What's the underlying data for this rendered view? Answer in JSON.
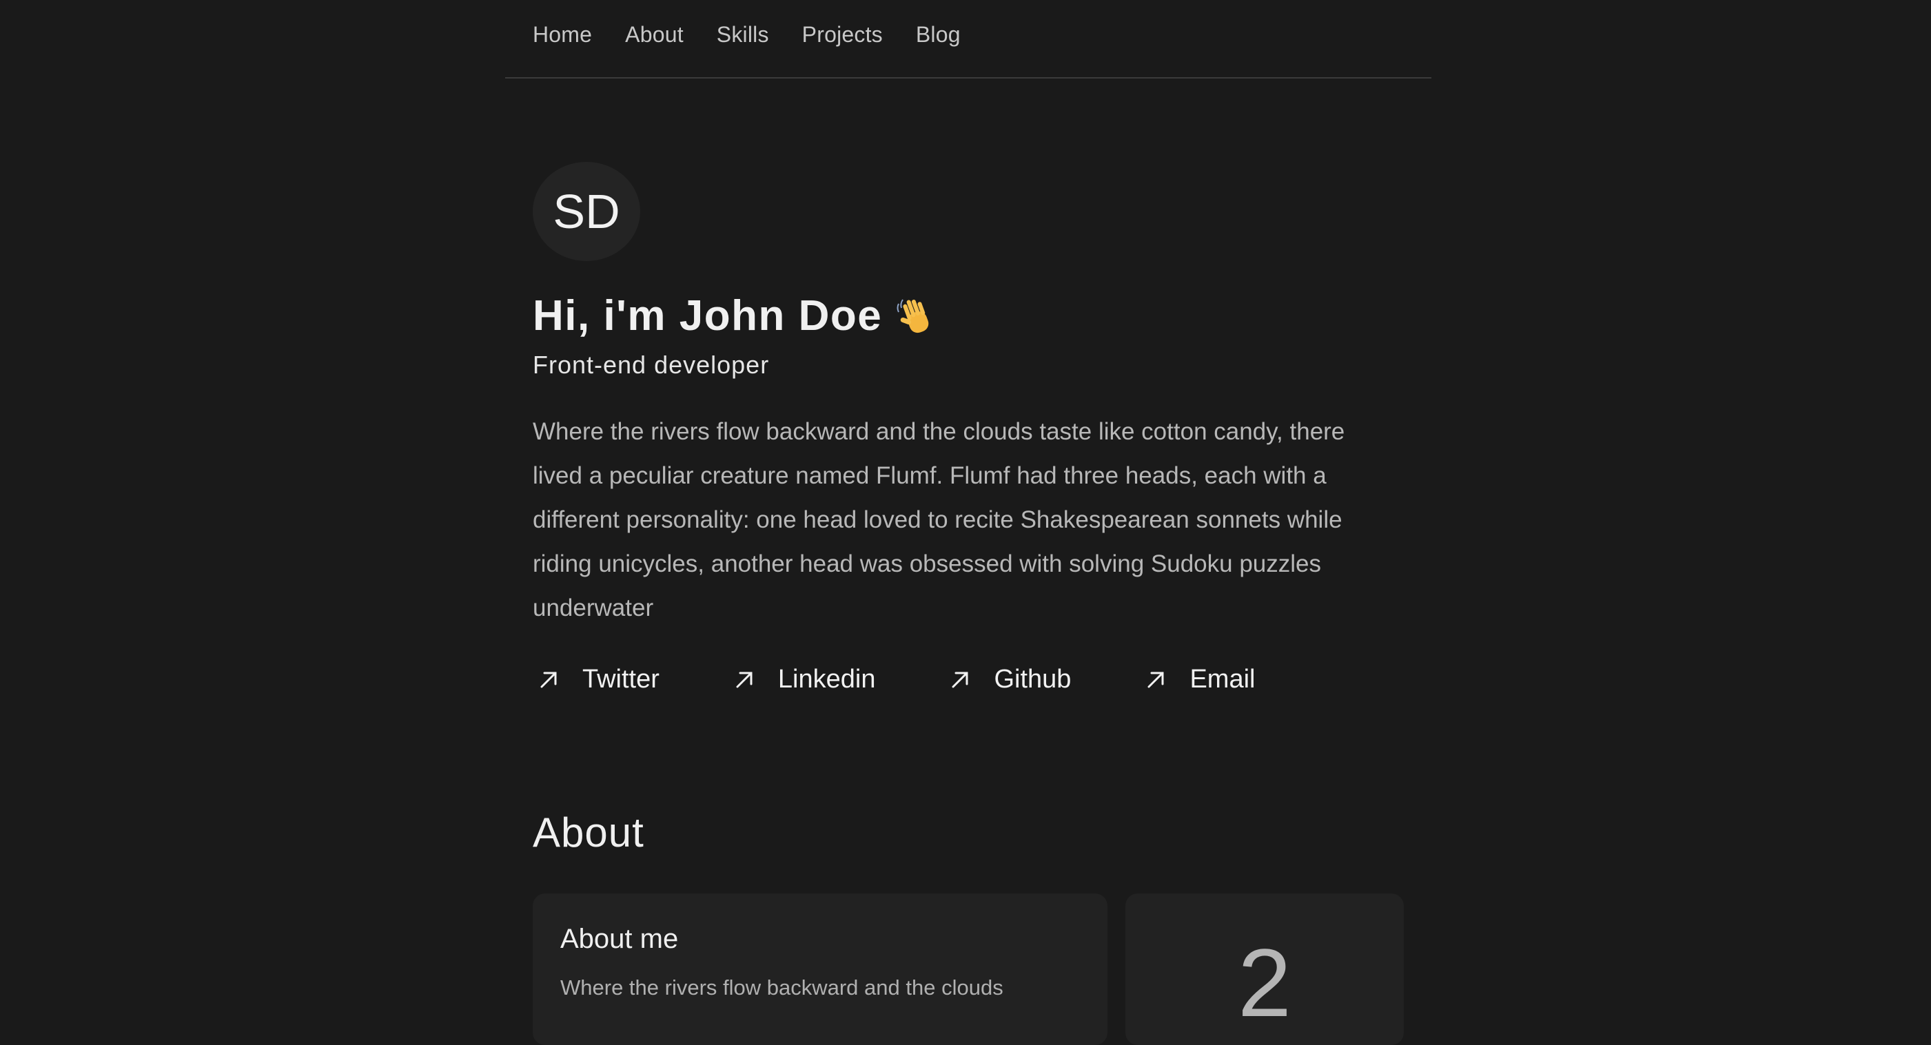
{
  "nav": {
    "items": [
      {
        "label": "Home"
      },
      {
        "label": "About"
      },
      {
        "label": "Skills"
      },
      {
        "label": "Projects"
      },
      {
        "label": "Blog"
      }
    ]
  },
  "hero": {
    "avatar_initials": "SD",
    "greeting": "Hi, i'm John Doe",
    "greeting_icon": "waving-hand-icon",
    "subtitle": "Front-end developer",
    "bio": "Where the rivers flow backward and the clouds taste like cotton candy, there lived a peculiar creature named Flumf. Flumf had three heads, each with a different personality: one head loved to recite Shakespearean sonnets while riding unicycles, another head was obsessed with solving Sudoku puzzles underwater"
  },
  "social": {
    "icon": "arrow-up-right-icon",
    "links": [
      {
        "label": "Twitter"
      },
      {
        "label": "Linkedin"
      },
      {
        "label": "Github"
      },
      {
        "label": "Email"
      }
    ]
  },
  "about": {
    "section_title": "About",
    "card_title": "About me",
    "card_text": "Where the rivers flow backward and the clouds",
    "stat_value": "2"
  },
  "colors": {
    "background": "#1a1a1a",
    "card": "#222222",
    "text_primary": "#f0f0f0",
    "text_muted": "#b8b8b8"
  }
}
